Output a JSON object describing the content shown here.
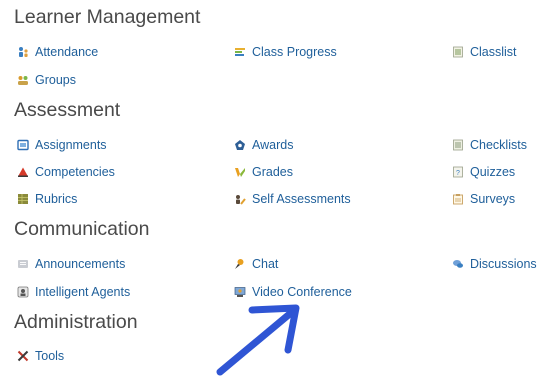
{
  "sections": {
    "learner_management": {
      "title": "Learner Management",
      "items": [
        "Attendance",
        "Class Progress",
        "Classlist",
        "Groups"
      ]
    },
    "assessment": {
      "title": "Assessment",
      "items": [
        "Assignments",
        "Awards",
        "Checklists",
        "Competencies",
        "Grades",
        "Quizzes",
        "Rubrics",
        "Self Assessments",
        "Surveys"
      ]
    },
    "communication": {
      "title": "Communication",
      "items": [
        "Announcements",
        "Chat",
        "Discussions",
        "Intelligent Agents",
        "Video Conference"
      ]
    },
    "administration": {
      "title": "Administration",
      "items": [
        "Tools"
      ]
    }
  },
  "colors": {
    "link": "#1f5f9a",
    "heading": "#4a4a4a",
    "arrow": "#2f55d4"
  },
  "icons": {
    "attendance": "people-icon",
    "class_progress": "progress-bars-icon",
    "classlist": "list-icon",
    "groups": "group-icon",
    "assignments": "dropbox-icon",
    "awards": "award-icon",
    "checklists": "checklist-icon",
    "competencies": "triangle-icon",
    "grades": "grades-icon",
    "quizzes": "quiz-icon",
    "rubrics": "rubric-icon",
    "self_assessments": "person-pencil-icon",
    "surveys": "survey-icon",
    "announcements": "announcement-icon",
    "chat": "chat-icon",
    "discussions": "discussion-icon",
    "intelligent_agents": "agent-icon",
    "video_conference": "video-conference-icon",
    "tools": "tools-icon"
  }
}
